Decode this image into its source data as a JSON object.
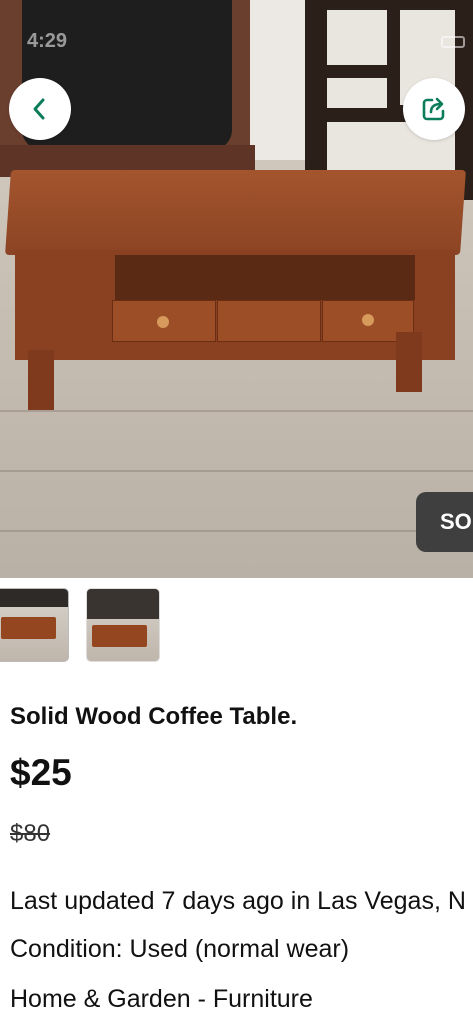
{
  "status_bar": {
    "time": "4:29"
  },
  "listing": {
    "title": "Solid Wood Coffee Table.",
    "price": "$25",
    "original_price": "$80",
    "last_updated": "Last updated 7 days ago in Las Vegas, N",
    "condition": "Condition: Used (normal wear)",
    "category": "Home & Garden - Furniture"
  },
  "badge": {
    "text": "SO"
  },
  "icons": {
    "back": "chevron-left-icon",
    "share": "share-icon"
  },
  "colors": {
    "accent": "#0b7d5a",
    "badge_bg": "#3f3f3f"
  },
  "thumbnails": [
    {
      "selected": true
    },
    {
      "selected": false
    }
  ]
}
